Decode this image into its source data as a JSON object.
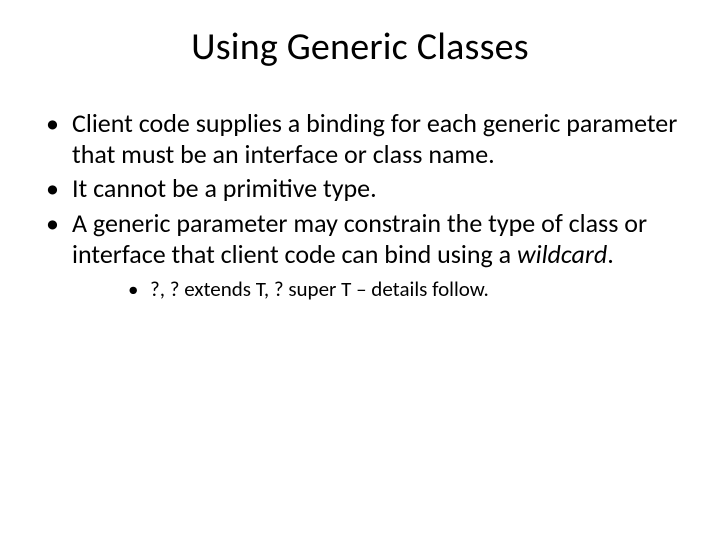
{
  "title": "Using Generic Classes",
  "bullets": [
    {
      "text": "Client code supplies a binding for each generic parameter that must be an interface or class name."
    },
    {
      "text": "It cannot be a primitive type."
    },
    {
      "pre": "A generic parameter may constrain the type of class or interface that client code can bind using a ",
      "em": "wildcard",
      "post": "."
    }
  ],
  "sub": [
    {
      "text": "?, ? extends T, ? super T – details follow."
    }
  ]
}
